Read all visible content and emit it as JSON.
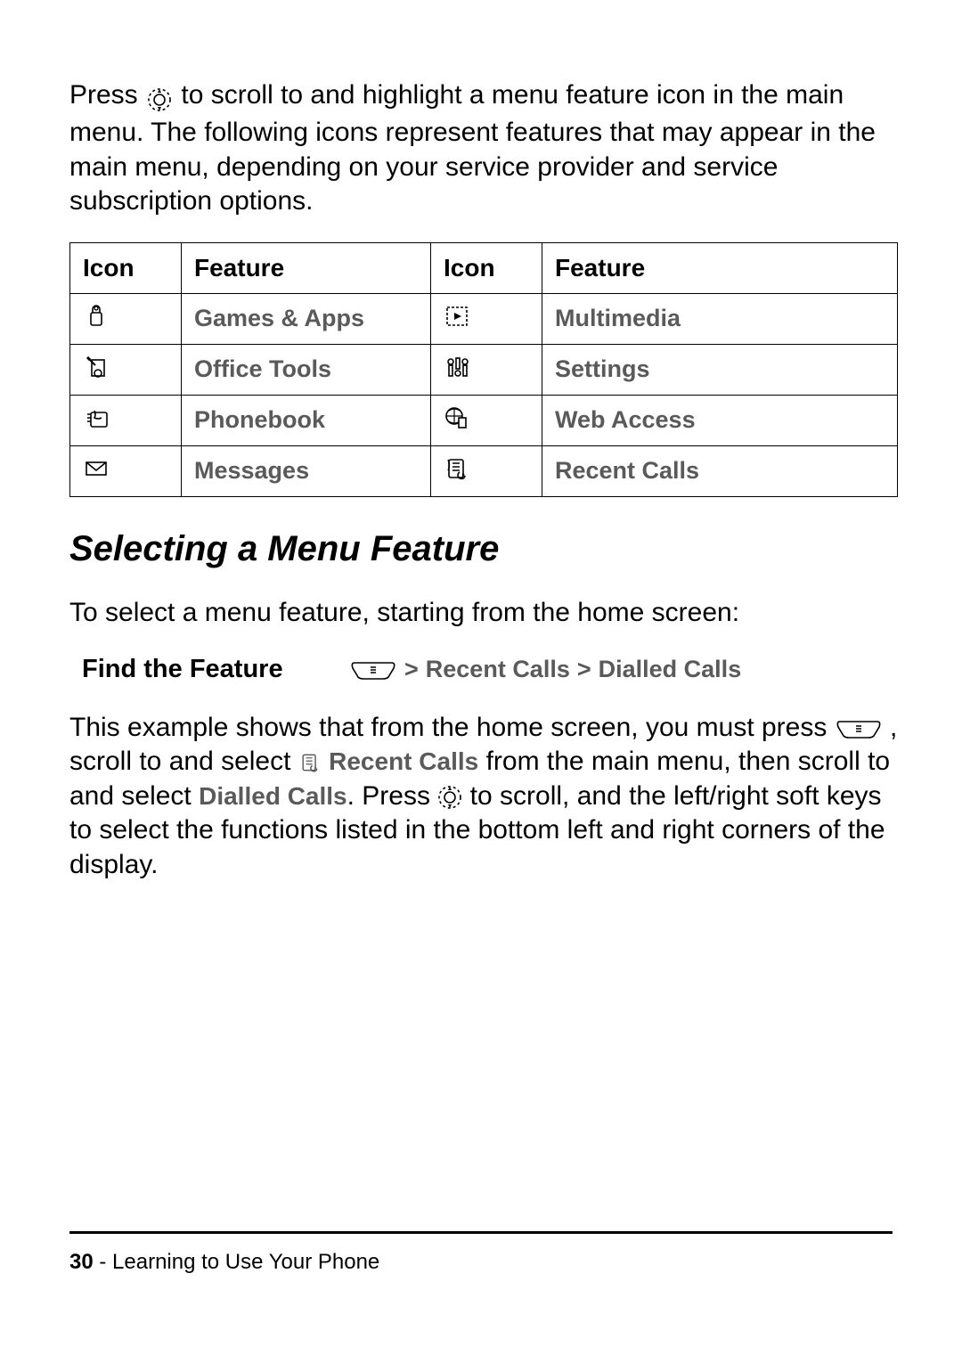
{
  "intro": {
    "press": "Press",
    "rest": "to scroll to and highlight a menu feature icon in the main menu. The following icons represent features that may appear in the main menu, depending on your service provider and service subscription options."
  },
  "table": {
    "headers": {
      "icon": "Icon",
      "feature": "Feature"
    },
    "rows": [
      {
        "left": "Games & Apps",
        "right": "Multimedia"
      },
      {
        "left": "Office Tools",
        "right": "Settings"
      },
      {
        "left": "Phonebook",
        "right": "Web Access"
      },
      {
        "left": "Messages",
        "right": "Recent Calls"
      }
    ]
  },
  "section_title": "Selecting a Menu Feature",
  "select_intro": "To select a menu feature, starting from the home screen:",
  "find": {
    "label": "Find the Feature",
    "gt": ">",
    "path1": "Recent Calls",
    "path2": "Dialled Calls"
  },
  "explain": {
    "t1": "This example shows that from the home screen, you must press",
    "t2": ", scroll to and select",
    "rc": "Recent Calls",
    "t3": "from the main menu, then scroll to and select",
    "dc": "Dialled Calls",
    "t4": ". Press",
    "t5": "to scroll, and the left/right soft keys to select the functions listed in the bottom left and right corners of the display."
  },
  "footer": {
    "page": "30",
    "sep": " - ",
    "title": "Learning to Use Your Phone"
  }
}
